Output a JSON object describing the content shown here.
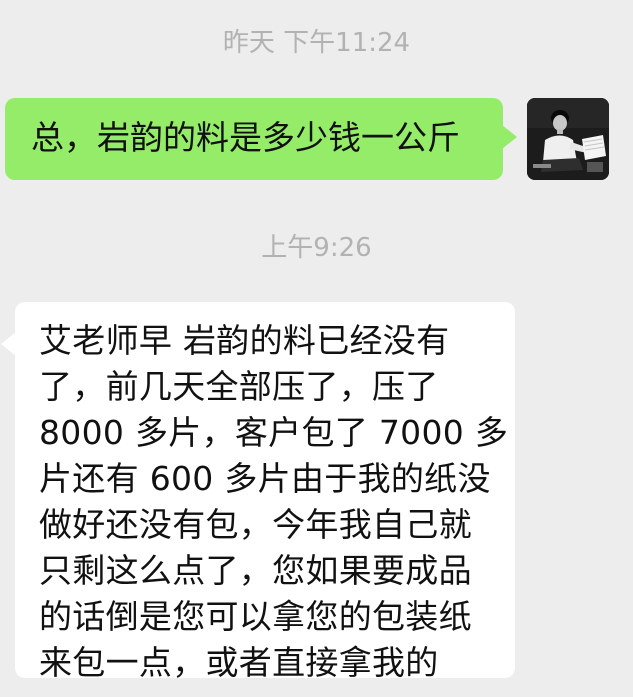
{
  "chat": {
    "timestamp_1": "昨天 下午11:24",
    "timestamp_2": "上午9:26",
    "outgoing_message": "总，岩韵的料是多少钱一公斤",
    "incoming_message_lines": [
      "艾老师早   岩韵的料已经没有",
      "了，前几天全部压了，压了",
      "8000 多片，客户包了 7000 多",
      "片还有 600 多片由于我的纸没",
      "做好还没有包，今年我自己就",
      "只剩这么点了，您如果要成品",
      "的话倒是您可以拿您的包装纸",
      "来包一点，或者直接拿我的"
    ]
  },
  "colors": {
    "background": "#ededed",
    "outgoing_bubble": "#95ec69",
    "incoming_bubble": "#ffffff",
    "timestamp_text": "#b2b2b2",
    "message_text": "#111111"
  },
  "icons": {
    "avatar": "user-photo-avatar"
  }
}
